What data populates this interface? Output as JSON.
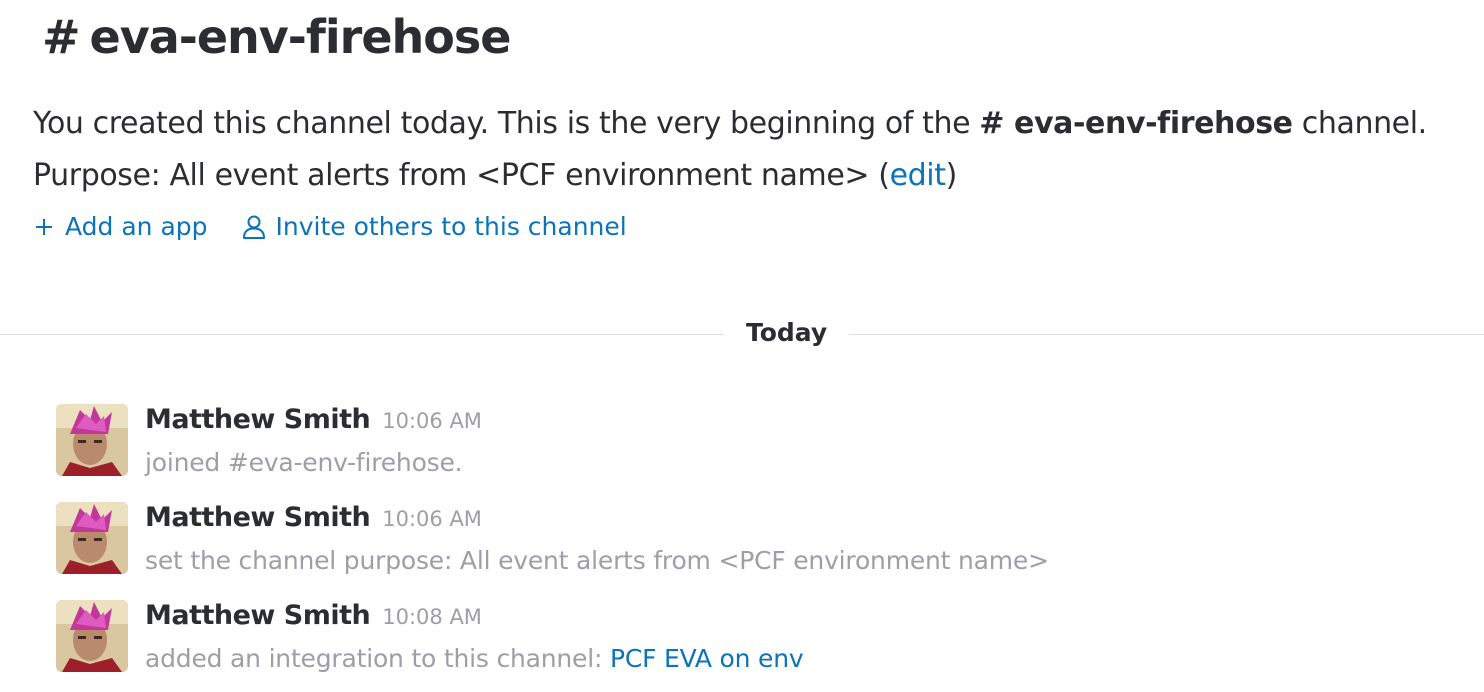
{
  "channel": {
    "hash": "#",
    "name": "eva-env-firehose"
  },
  "intro": {
    "text_before": "You created this channel today. This is the very beginning of the ",
    "channel_ref": "# eva-env-firehose",
    "text_after": " channel.",
    "purpose_prefix": "Purpose: All event alerts from <PCF environment name> (",
    "edit_link": "edit",
    "purpose_suffix": ")"
  },
  "actions": {
    "add_app": "Add an app",
    "invite": "Invite others to this channel"
  },
  "divider": {
    "label": "Today"
  },
  "messages": [
    {
      "author": "Matthew Smith",
      "time": "10:06 AM",
      "text": "joined #eva-env-firehose.",
      "link": ""
    },
    {
      "author": "Matthew Smith",
      "time": "10:06 AM",
      "text": "set the channel purpose: All event alerts from <PCF environment name>",
      "link": ""
    },
    {
      "author": "Matthew Smith",
      "time": "10:08 AM",
      "text": "added an integration to this channel: ",
      "link": "PCF EVA on env"
    }
  ],
  "colors": {
    "link": "#0b74b8",
    "text": "#2c2d30",
    "muted": "#9e9ea6"
  },
  "icons": {
    "add_app": "plus-icon",
    "invite": "person-icon"
  }
}
